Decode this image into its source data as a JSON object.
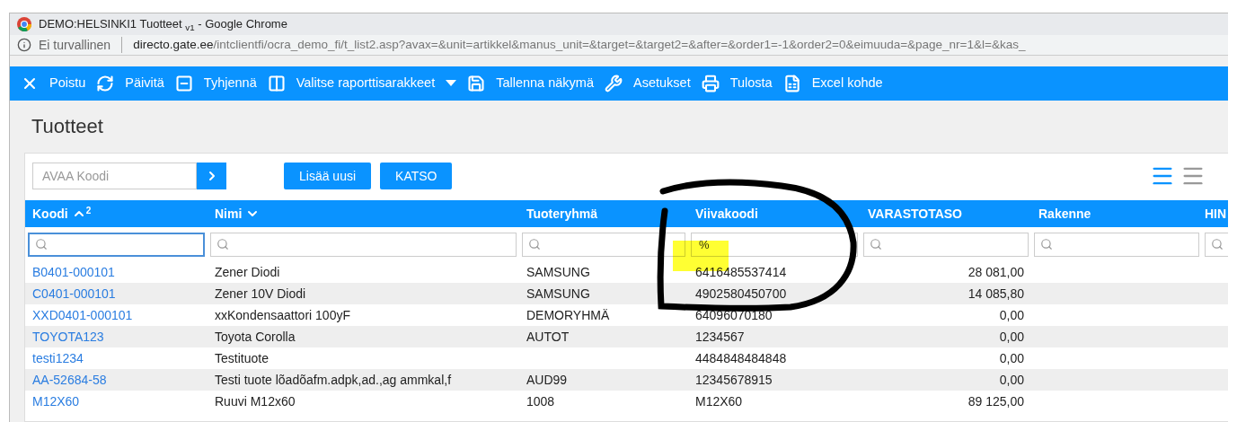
{
  "window": {
    "title": "DEMO:HELSINKI1 Tuotteet $_{v1}$ - Google Chrome"
  },
  "address_bar": {
    "security": "Ei turvallinen",
    "url_host": "directo.gate.ee",
    "url_path": "/intclientfi/ocra_demo_fi/t_list2.asp?avax=&unit=artikkel&manus_unit=&target=&target2=&after=&order1=-1&order2=0&eimuuda=&page_nr=1&l=&kas_"
  },
  "toolbar": [
    {
      "label": "Poistu",
      "has_menu": false
    },
    {
      "label": "Päivitä",
      "has_menu": false
    },
    {
      "label": "Tyhjennä",
      "has_menu": false
    },
    {
      "label": "Valitse raporttisarakkeet",
      "has_menu": true
    },
    {
      "label": "Tallenna näkymä",
      "has_menu": false
    },
    {
      "label": "Asetukset",
      "has_menu": false
    },
    {
      "label": "Tulosta",
      "has_menu": false
    },
    {
      "label": "Excel kohde",
      "has_menu": false
    }
  ],
  "page": {
    "title": "Tuotteet"
  },
  "open_field": {
    "placeholder": "AVAA Koodi"
  },
  "buttons": [
    "Lisää uusi",
    "KATSO"
  ],
  "view_modes": [
    {
      "selected": true
    },
    {
      "selected": false
    }
  ],
  "table": {
    "columns": [
      {
        "label": "Koodi",
        "sorted_ascending": true,
        "sort_rank": "2",
        "focused": true
      },
      {
        "label": "Nimi",
        "sorted_ascending": false,
        "focused": false
      },
      {
        "label": "Tuoteryhmä",
        "focused": false
      },
      {
        "label": "Viivakoodi",
        "filter": "%",
        "focused": false
      },
      {
        "label": "VARASTOTASO",
        "focused": false,
        "numeric": true
      },
      {
        "label": "Rakenne",
        "focused": false
      },
      {
        "label": "HIN",
        "focused": false
      }
    ],
    "rows": [
      [
        "B0401-000101",
        "Zener Diodi",
        "SAMSUNG",
        "6416485537414",
        "28 081,00"
      ],
      [
        "C0401-000101",
        "Zener 10V Diodi",
        "SAMSUNG",
        "4902580450700",
        "14 085,80"
      ],
      [
        "XXD0401-000101",
        "xxKondensaattori 100yF",
        "DEMORYHMÄ",
        "64096070180",
        "0,00"
      ],
      [
        "TOYOTA123",
        "Toyota Corolla",
        "AUTOT",
        "1234567",
        "0,00"
      ],
      [
        "testi1234",
        "Testituote",
        null,
        "4484848484848",
        "0,00"
      ],
      [
        "AA-52684-58",
        "Testi tuote lõadõafm.adpk,ad.,ag ammkal,f",
        "AUD99",
        "12345678915",
        "0,00"
      ],
      [
        "M12X60",
        "Ruuvi M12x60",
        "1008",
        "M12X60",
        "89 125,00"
      ]
    ]
  }
}
